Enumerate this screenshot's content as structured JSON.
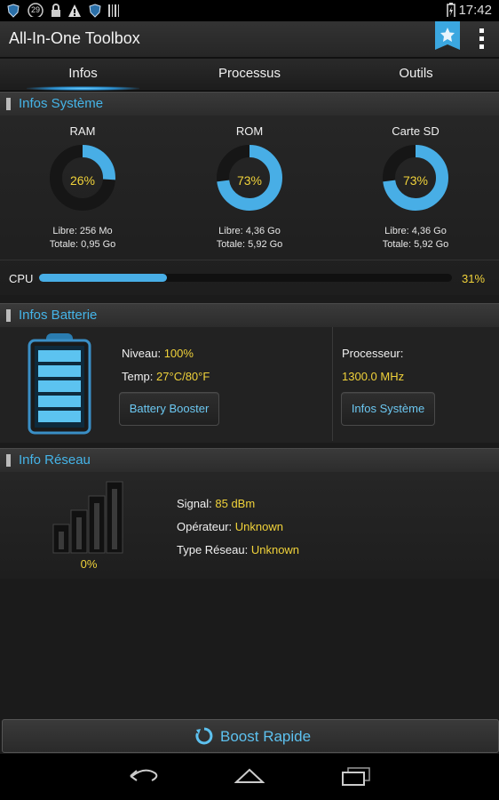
{
  "status_bar": {
    "time": "17:42",
    "notification_count": "29",
    "icons": [
      "shield-icon",
      "notification-count-icon",
      "lock-icon",
      "warning-icon",
      "shield-icon",
      "barcode-icon",
      "battery-charging-icon"
    ]
  },
  "app": {
    "title": "All-In-One Toolbox",
    "star_icon": "star-icon",
    "menu_icon": "overflow-menu-icon"
  },
  "tabs": [
    {
      "label": "Infos",
      "active": true
    },
    {
      "label": "Processus",
      "active": false
    },
    {
      "label": "Outils",
      "active": false
    }
  ],
  "system": {
    "header": "Infos Système",
    "ram": {
      "title": "RAM",
      "percent": "26%",
      "fraction": 0.26,
      "free": "Libre: 256 Mo",
      "total": "Totale: 0,95 Go"
    },
    "rom": {
      "title": "ROM",
      "percent": "73%",
      "fraction": 0.73,
      "free": "Libre: 4,36 Go",
      "total": "Totale: 5,92 Go"
    },
    "sd": {
      "title": "Carte SD",
      "percent": "73%",
      "fraction": 0.73,
      "free": "Libre: 4,36 Go",
      "total": "Totale: 5,92 Go"
    },
    "cpu": {
      "label": "CPU",
      "value": "31%",
      "fraction": 0.31
    }
  },
  "battery": {
    "header": "Infos Batterie",
    "level_label": "Niveau:",
    "level_value": "100%",
    "temp_label": "Temp:",
    "temp_value": "27°C/80°F",
    "booster_button": "Battery Booster",
    "processor_label": "Processeur:",
    "processor_value": "1300.0 MHz",
    "system_button": "Infos Système",
    "level_fraction": 1.0
  },
  "network": {
    "header": "Info Réseau",
    "signal_percent": "0%",
    "signal_label": "Signal:",
    "signal_value": "85 dBm",
    "operator_label": "Opérateur:",
    "operator_value": "Unknown",
    "type_label": "Type Réseau:",
    "type_value": "Unknown"
  },
  "boost": {
    "label": "Boost Rapide",
    "icon": "boost-refresh-icon"
  },
  "nav": {
    "icons": [
      "back-icon",
      "home-icon",
      "recents-icon"
    ]
  },
  "colors": {
    "accent": "#48aee6",
    "value_yellow": "#f0d23a",
    "header_blue": "#45b4e8"
  }
}
